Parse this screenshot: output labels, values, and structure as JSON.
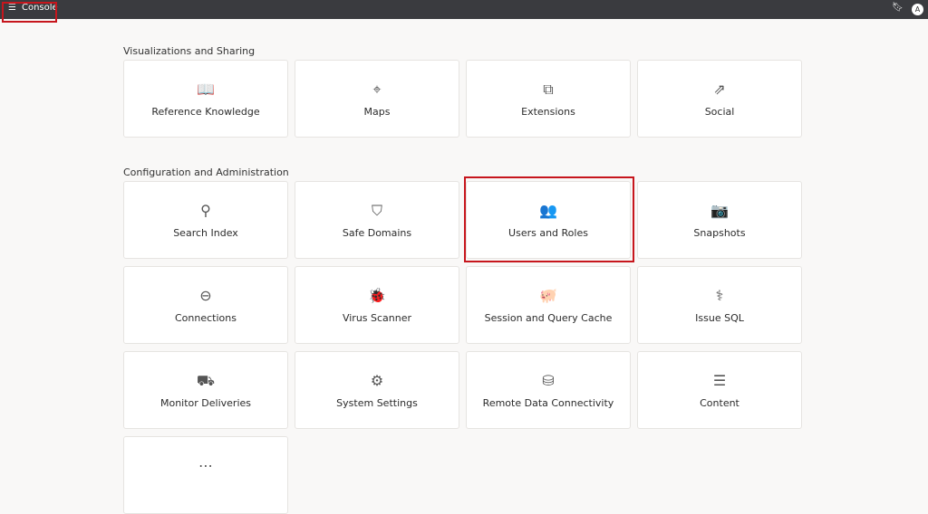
{
  "header": {
    "title": "Console",
    "avatar": "A",
    "menu_icon": "hamburger-icon",
    "bookmark_icon": "bookmark-icon"
  },
  "sections": [
    {
      "title": "Visualizations and Sharing",
      "items": [
        {
          "label": "Reference Knowledge",
          "icon": "📖"
        },
        {
          "label": "Maps",
          "icon": "⌖"
        },
        {
          "label": "Extensions",
          "icon": "⧉"
        },
        {
          "label": "Social",
          "icon": "⇗"
        }
      ]
    },
    {
      "title": "Configuration and Administration",
      "items": [
        {
          "label": "Search Index",
          "icon": "⚲"
        },
        {
          "label": "Safe Domains",
          "icon": "⛉"
        },
        {
          "label": "Users and Roles",
          "icon": "👥"
        },
        {
          "label": "Snapshots",
          "icon": "📷"
        },
        {
          "label": "Connections",
          "icon": "⊖"
        },
        {
          "label": "Virus Scanner",
          "icon": "🐞"
        },
        {
          "label": "Session and Query Cache",
          "icon": "🐖"
        },
        {
          "label": "Issue SQL",
          "icon": "⚕"
        },
        {
          "label": "Monitor Deliveries",
          "icon": "⛟"
        },
        {
          "label": "System Settings",
          "icon": "⚙"
        },
        {
          "label": "Remote Data Connectivity",
          "icon": "⛁"
        },
        {
          "label": "Content",
          "icon": "☰"
        },
        {
          "label": "",
          "icon": "⋯"
        }
      ]
    }
  ]
}
